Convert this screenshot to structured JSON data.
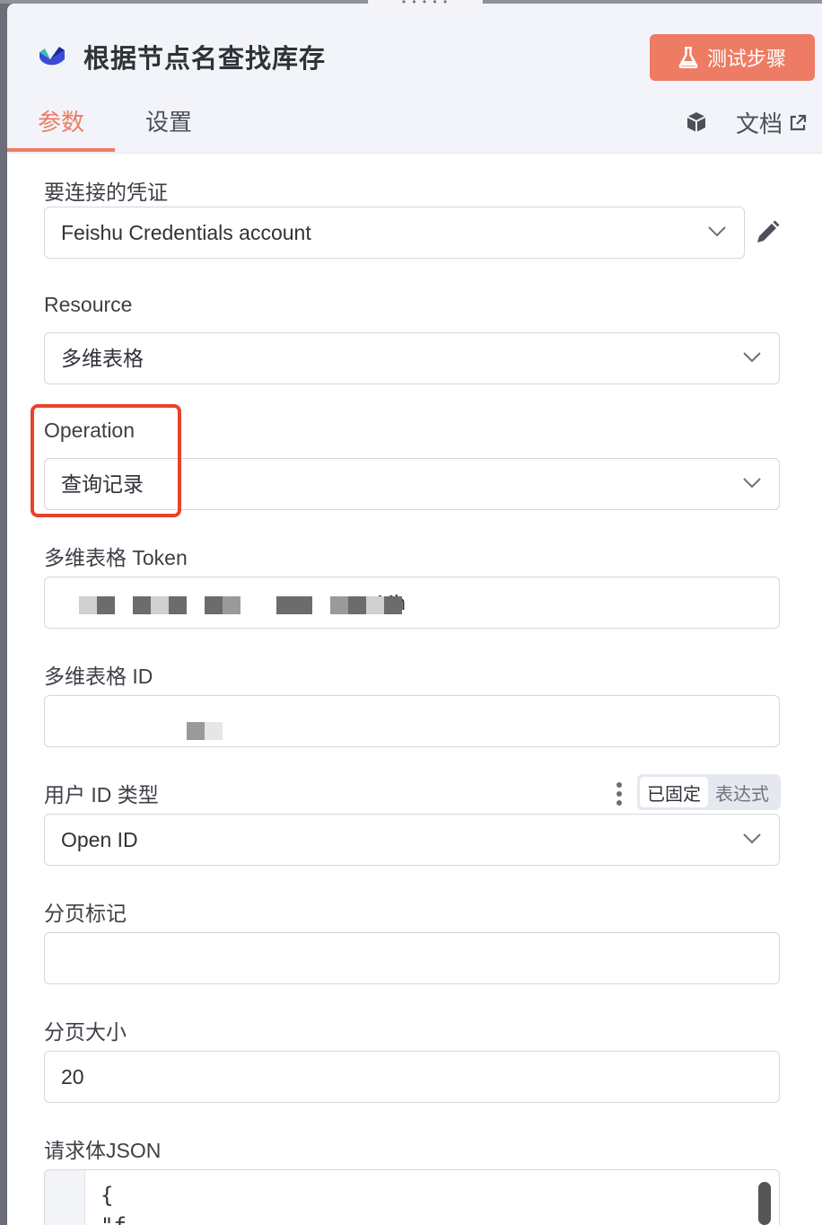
{
  "header": {
    "title": "根据节点名查找库存",
    "test_button_label": "测试步骤",
    "node_icon": "feishu-bitable-icon",
    "accent_color": "#ee7b63"
  },
  "tabs": [
    {
      "label": "参数",
      "active": true
    },
    {
      "label": "设置",
      "active": false
    }
  ],
  "docs_label": "文档",
  "fields": {
    "credential": {
      "label": "要连接的凭证",
      "value": "Feishu Credentials account"
    },
    "resource": {
      "label": "Resource",
      "value": "多维表格"
    },
    "operation": {
      "label": "Operation",
      "value": "查询记录"
    },
    "bitable_token": {
      "label": "多维表格 Token",
      "value": "Mh"
    },
    "bitable_id": {
      "label": "多维表格 ID",
      "value": ""
    },
    "user_id_type": {
      "label": "用户 ID 类型",
      "value": "Open ID",
      "toggle_fixed": "已固定",
      "toggle_expression": "表达式"
    },
    "page_token": {
      "label": "分页标记",
      "value": ""
    },
    "page_size": {
      "label": "分页大小",
      "value": "20"
    },
    "request_body": {
      "label": "请求体JSON",
      "line1": "{",
      "line2": "  \"f"
    }
  },
  "highlight_color": "#e8442c"
}
